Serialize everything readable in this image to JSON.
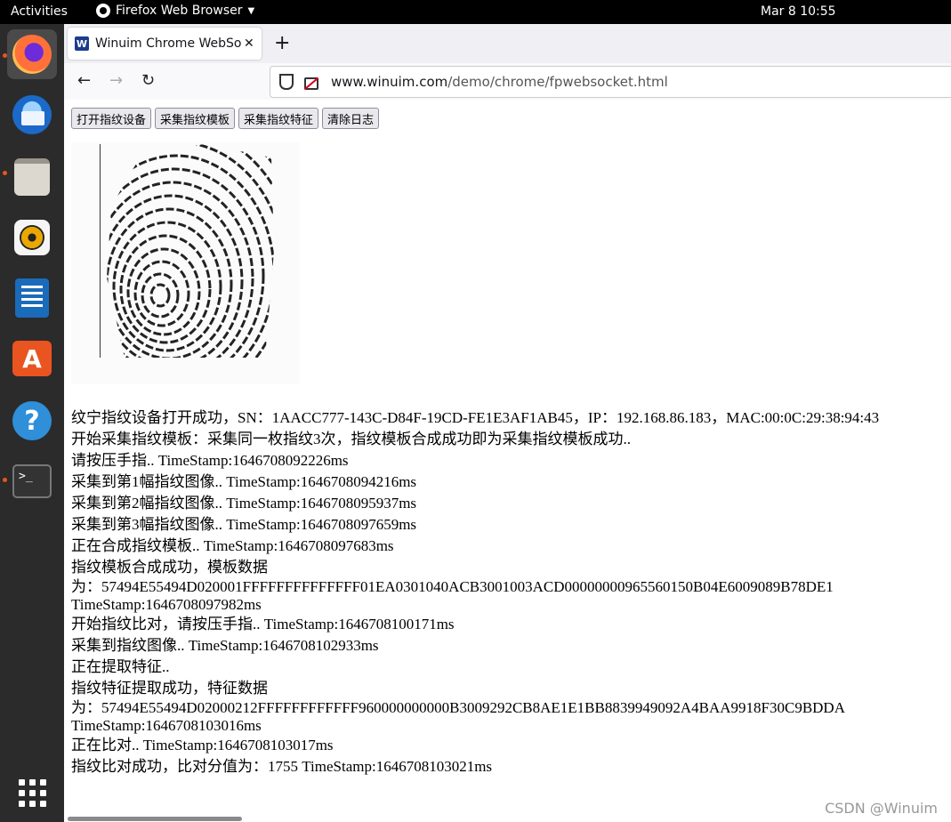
{
  "topbar": {
    "activities": "Activities",
    "app_name": "Firefox Web Browser",
    "clock": "Mar 8  10:55"
  },
  "dock": {
    "items": [
      "firefox-icon",
      "thunderbird-icon",
      "files-icon",
      "rhythmbox-icon",
      "libreoffice-writer-icon",
      "software-icon",
      "help-icon",
      "terminal-icon",
      "show-apps-icon"
    ]
  },
  "browser": {
    "tab_title": "Winuim Chrome WebSocket",
    "tab_favicon": "W",
    "newtab": "+",
    "url_host": "www.winuim.com",
    "url_path": "/demo/chrome/fpwebsocket.html"
  },
  "page": {
    "buttons": [
      "打开指纹设备",
      "采集指纹模板",
      "采集指纹特征",
      "清除日志"
    ],
    "log": [
      "纹宁指纹设备打开成功，SN：1AACC777-143C-D84F-19CD-FE1E3AF1AB45，IP：192.168.86.183，MAC:00:0C:29:38:94:43",
      "开始采集指纹模板：采集同一枚指纹3次，指纹模板合成成功即为采集指纹模板成功..",
      "请按压手指.. TimeStamp:1646708092226ms",
      "采集到第1幅指纹图像.. TimeStamp:1646708094216ms",
      "采集到第2幅指纹图像.. TimeStamp:1646708095937ms",
      "采集到第3幅指纹图像.. TimeStamp:1646708097659ms",
      "正在合成指纹模板.. TimeStamp:1646708097683ms",
      "指纹模板合成成功，模板数据",
      "为：57494E55494D020001FFFFFFFFFFFFFF01EA0301040ACB3001003ACD00000000965560150B04E6009089B78DE1",
      "TimeStamp:1646708097982ms",
      "开始指纹比对，请按压手指.. TimeStamp:1646708100171ms",
      "采集到指纹图像.. TimeStamp:1646708102933ms",
      "正在提取特征..",
      "指纹特征提取成功，特征数据",
      "为：57494E55494D02000212FFFFFFFFFFFF960000000000B3009292CB8AE1E1BB8839949092A4BAA9918F30C9BDDA",
      "TimeStamp:1646708103016ms",
      "正在比对.. TimeStamp:1646708103017ms",
      "指纹比对成功，比对分值为：1755 TimeStamp:1646708103021ms"
    ],
    "watermark": "CSDN @Winuim"
  }
}
